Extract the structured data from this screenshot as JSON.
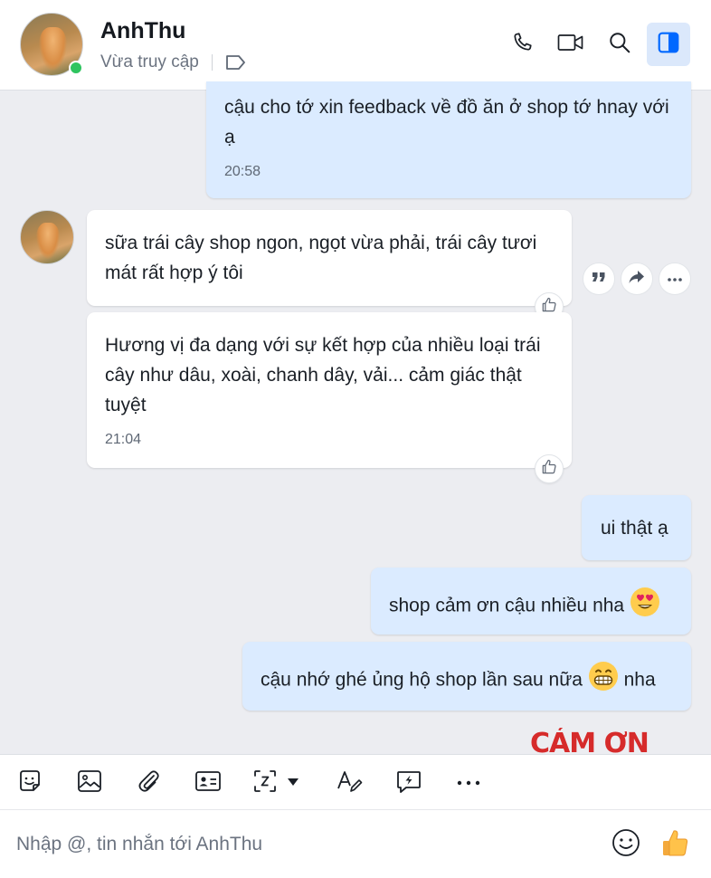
{
  "contact": {
    "name": "AnhThu",
    "status": "Vừa truy cập"
  },
  "messages": [
    {
      "side": "me",
      "text": "cậu cho tớ xin feedback về đồ ăn ở shop tớ hnay với ạ",
      "time": "20:58"
    },
    {
      "side": "them",
      "text": "sữa trái cây shop ngon, ngọt vừa phải, trái cây tươi mát rất hợp ý tôi"
    },
    {
      "side": "them",
      "text": "Hương vị đa dạng với sự kết hợp của nhiều loại trái cây như dâu, xoài, chanh dây, vải... cảm giác thật tuyệt",
      "time": "21:04"
    },
    {
      "side": "me",
      "text": "ui thật ạ"
    },
    {
      "side": "me",
      "text": "shop cảm ơn cậu nhiều nha"
    },
    {
      "side": "me",
      "text_before": "cậu nhớ ghé ủng hộ shop lần sau nữa",
      "text_after": "nha"
    }
  ],
  "sticker_text": "CẢM ƠN",
  "composer": {
    "placeholder": "Nhập @, tin nhắn tới AnhThu"
  },
  "icons": {
    "header": [
      "phone-icon",
      "video-call-icon",
      "search-icon",
      "sidebar-toggle-icon"
    ],
    "toolbar": [
      "sticker-icon",
      "image-icon",
      "attachment-icon",
      "contact-card-icon",
      "screenshot-icon",
      "format-text-icon",
      "quick-message-icon",
      "more-icon"
    ]
  },
  "colors": {
    "accent": "#0068ff",
    "my_bubble": "#dbebff",
    "their_bubble": "#ffffff",
    "background": "#ecedf1",
    "online": "#2ec45f"
  }
}
